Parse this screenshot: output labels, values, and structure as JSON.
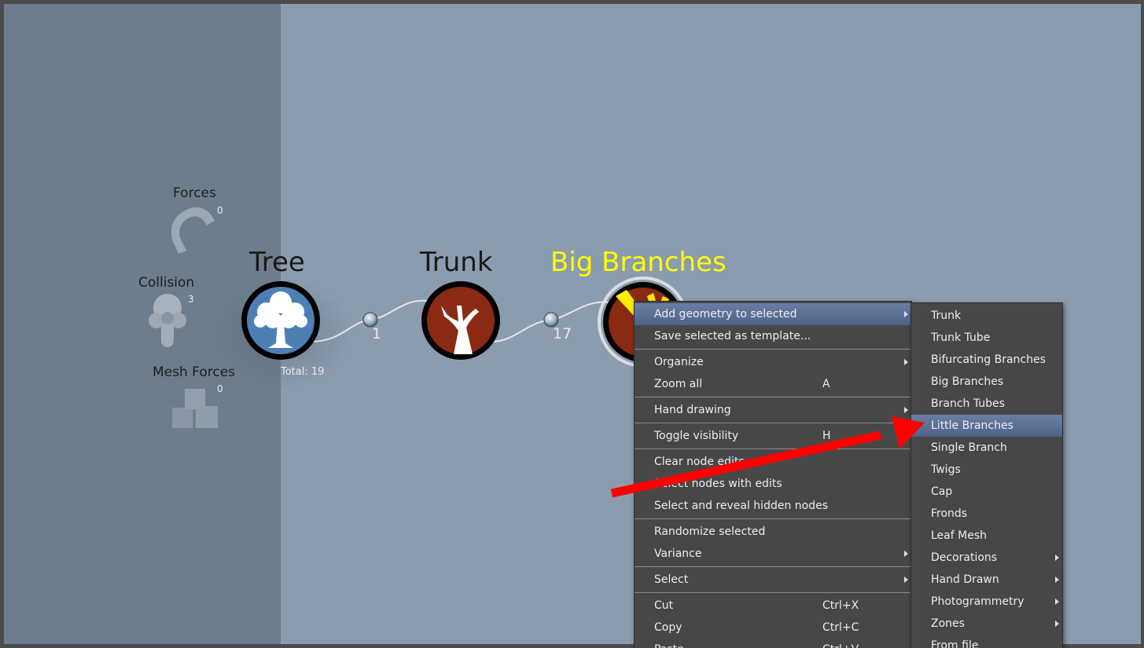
{
  "side_panel": {
    "forces": {
      "label": "Forces",
      "count": "0"
    },
    "collision": {
      "label": "Collision",
      "count": "3"
    },
    "mesh_forces": {
      "label": "Mesh Forces",
      "count": "0"
    }
  },
  "graph": {
    "nodes": [
      {
        "title": "Tree",
        "icon": "tree-icon",
        "color": "#4e7fb4"
      },
      {
        "title": "Trunk",
        "icon": "trunk-icon",
        "color": "#8b2a12"
      },
      {
        "title": "Big Branches",
        "icon": "big-branches-icon",
        "color": "#8b2a12",
        "title_color": "#ffff00"
      }
    ],
    "connections": [
      "1",
      "17"
    ],
    "total": "Total: 19"
  },
  "context_menu": {
    "items": [
      {
        "label": "Add geometry to selected",
        "shortcut": "",
        "submenu": true,
        "highlighted": true
      },
      {
        "label": "Save selected as template...",
        "shortcut": "",
        "submenu": false
      },
      {
        "separator": true
      },
      {
        "label": "Organize",
        "shortcut": "",
        "submenu": true
      },
      {
        "label": "Zoom all",
        "shortcut": "A",
        "submenu": false
      },
      {
        "separator": true
      },
      {
        "label": "Hand drawing",
        "shortcut": "",
        "submenu": true
      },
      {
        "separator": true
      },
      {
        "label": "Toggle visibility",
        "shortcut": "H",
        "submenu": false
      },
      {
        "separator": true
      },
      {
        "label": "Clear node edits",
        "shortcut": "",
        "submenu": false
      },
      {
        "label": "Select nodes with edits",
        "shortcut": "",
        "submenu": false
      },
      {
        "label": "Select and reveal hidden nodes",
        "shortcut": "",
        "submenu": false
      },
      {
        "separator": true
      },
      {
        "label": "Randomize selected",
        "shortcut": "",
        "submenu": false
      },
      {
        "label": "Variance",
        "shortcut": "",
        "submenu": true
      },
      {
        "separator": true
      },
      {
        "label": "Select",
        "shortcut": "",
        "submenu": true
      },
      {
        "separator": true
      },
      {
        "label": "Cut",
        "shortcut": "Ctrl+X",
        "submenu": false
      },
      {
        "label": "Copy",
        "shortcut": "Ctrl+C",
        "submenu": false
      },
      {
        "label": "Paste",
        "shortcut": "Ctrl+V",
        "submenu": false
      }
    ]
  },
  "geometry_submenu": {
    "items": [
      {
        "label": "Trunk",
        "submenu": false
      },
      {
        "label": "Trunk Tube",
        "submenu": false
      },
      {
        "label": "Bifurcating Branches",
        "submenu": false
      },
      {
        "label": "Big Branches",
        "submenu": false
      },
      {
        "label": "Branch Tubes",
        "submenu": false
      },
      {
        "label": "Little Branches",
        "submenu": false,
        "highlighted": true
      },
      {
        "label": "Single Branch",
        "submenu": false
      },
      {
        "label": "Twigs",
        "submenu": false
      },
      {
        "label": "Cap",
        "submenu": false
      },
      {
        "label": "Fronds",
        "submenu": false
      },
      {
        "label": "Leaf Mesh",
        "submenu": false
      },
      {
        "label": "Decorations",
        "submenu": true
      },
      {
        "label": "Hand Drawn",
        "submenu": true
      },
      {
        "label": "Photogrammetry",
        "submenu": true
      },
      {
        "label": "Zones",
        "submenu": true
      },
      {
        "label": "From file",
        "submenu": false
      }
    ]
  },
  "annotation": {
    "arrow_color": "#ff0000"
  }
}
